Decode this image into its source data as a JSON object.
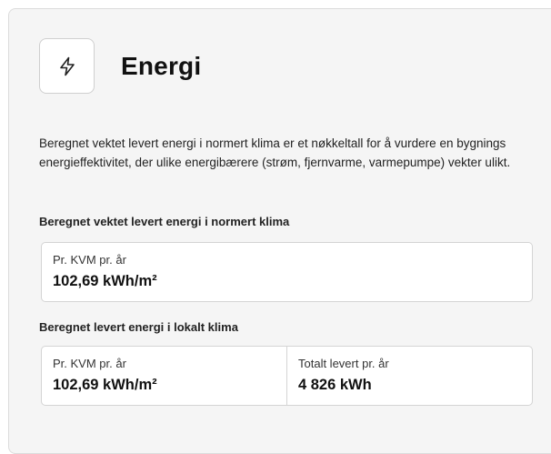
{
  "section": {
    "title": "Energi",
    "icon": "lightning-bolt-icon",
    "description": "Beregnet vektet levert energi i normert klima er et nøkkeltall for å vurdere en bygnings energieffektivitet, der ulike energibærere (strøm, fjernvarme, varmepumpe) vekter ulikt."
  },
  "normert": {
    "heading": "Beregnet vektet levert energi i normert klima",
    "per_kvm_label": "Pr. KVM pr. år",
    "per_kvm_value": "102,69 kWh/m²"
  },
  "lokalt": {
    "heading": "Beregnet levert energi i lokalt klima",
    "per_kvm_label": "Pr. KVM pr. år",
    "per_kvm_value": "102,69 kWh/m²",
    "total_label": "Totalt levert pr. år",
    "total_value": "4 826 kWh"
  }
}
